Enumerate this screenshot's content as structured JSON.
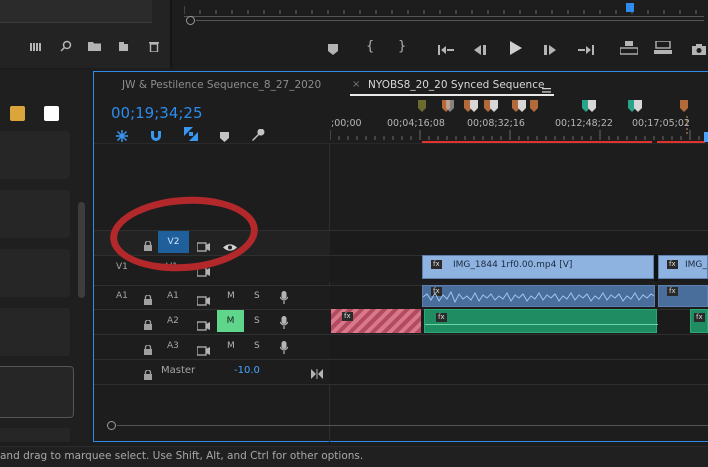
{
  "status_bar": {
    "text": "and drag to marquee select. Use Shift, Alt, and Ctrl for other options."
  },
  "tabs": [
    {
      "label": "JW & Pestilence Sequence_8_27_2020",
      "active": false
    },
    {
      "label": "NYOBS8_20_20 Synced Sequence",
      "active": true
    }
  ],
  "tab_menu_icon": "hamburger-icon",
  "timecode": "00;19;34;25",
  "ruler": {
    "labels": [
      ";00;00",
      "00;04;16;08",
      "00;08;32;16",
      "00;12;48;22",
      "00;17;05;02"
    ]
  },
  "tracks": {
    "video": [
      {
        "source": "",
        "name": "V2",
        "toggle": "eye-icon"
      },
      {
        "source": "V1",
        "name": "V1"
      }
    ],
    "audio": [
      {
        "source": "A1",
        "name": "A1",
        "m": "M",
        "s": "S"
      },
      {
        "source": "",
        "name": "A2",
        "m": "M",
        "s": "S",
        "m_active": true
      },
      {
        "source": "",
        "name": "A3",
        "m": "M",
        "s": "S"
      }
    ],
    "master": {
      "label": "Master",
      "value": "-10.0"
    }
  },
  "clips": {
    "v1_clip1": "IMG_1844 1rf0.00.mp4 [V]",
    "v1_clip2": "IMG_",
    "fx_badge": "fx"
  },
  "colors": {
    "accent_blue": "#2d8ceb",
    "swatch_yellow": "#dba53a",
    "swatch_white": "#ffffff",
    "video_clip": "#8fb3e0",
    "audio_clip": "#1f8c62",
    "audio_clip_dark": "#4a6e9c",
    "playhead": "#4aa3ff",
    "redline": "#e0332e",
    "annotation_circle": "#b3282a",
    "mute_active": "#5fd68c"
  },
  "icons": {
    "left_toolbar": [
      "list-view-icon",
      "search-icon",
      "folder-icon",
      "new-item-icon",
      "trash-icon"
    ],
    "transport": [
      "marker-icon",
      "mark-in-icon",
      "mark-out-icon",
      "go-to-in-icon",
      "step-back-icon",
      "play-icon",
      "step-forward-icon",
      "go-to-out-icon",
      "lift-icon",
      "extract-icon",
      "camera-icon"
    ],
    "timeline_tools": [
      "snap-icon",
      "magnet-icon",
      "linked-selection-icon",
      "add-marker-icon",
      "wrench-icon"
    ]
  }
}
